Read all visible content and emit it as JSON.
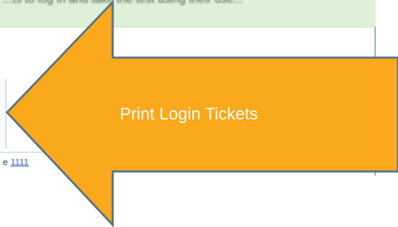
{
  "banner": {
    "text": "...ts to log in and take the test using their use..."
  },
  "table": {
    "partial_cell_prefix": "e",
    "partial_cell_link": "1111"
  },
  "callout": {
    "label": "Print Login Tickets",
    "fill": "#f9a91b",
    "stroke": "#5a7389"
  }
}
